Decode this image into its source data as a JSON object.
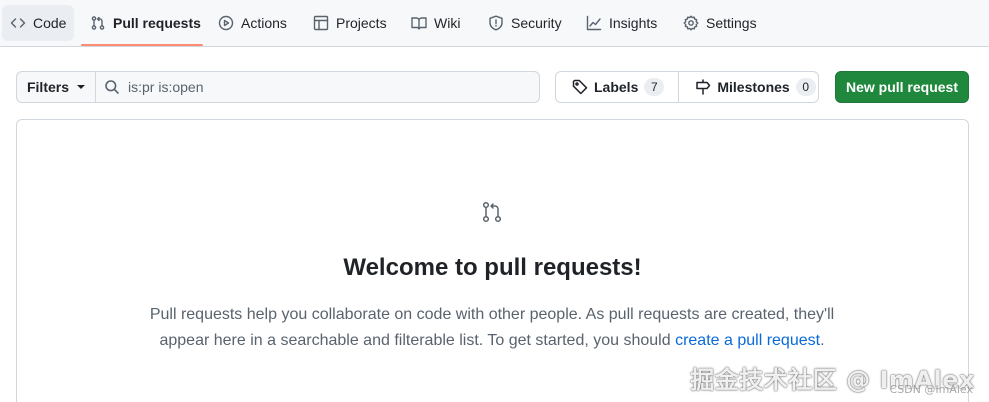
{
  "nav": {
    "tabs": [
      {
        "label": "Code",
        "icon": "code-icon"
      },
      {
        "label": "Pull requests",
        "icon": "git-pull-request-icon",
        "selected": true
      },
      {
        "label": "Actions",
        "icon": "play-icon"
      },
      {
        "label": "Projects",
        "icon": "table-icon"
      },
      {
        "label": "Wiki",
        "icon": "book-icon"
      },
      {
        "label": "Security",
        "icon": "shield-icon"
      },
      {
        "label": "Insights",
        "icon": "graph-icon"
      },
      {
        "label": "Settings",
        "icon": "gear-icon"
      }
    ]
  },
  "toolbar": {
    "filters_label": "Filters",
    "search_value": "is:pr is:open",
    "labels_label": "Labels",
    "labels_count": "7",
    "milestones_label": "Milestones",
    "milestones_count": "0",
    "new_pr_label": "New pull request"
  },
  "blankslate": {
    "title": "Welcome to pull requests!",
    "text_before_link": "Pull requests help you collaborate on code with other people. As pull requests are created, they'll appear here in a searchable and filterable list. To get started, you should ",
    "link_text": "create a pull request",
    "text_after_link": "."
  },
  "watermark": {
    "main": "掘金技术社区 @ ImAlex",
    "secondary": "CSDN @ImAlex"
  },
  "colors": {
    "accent_underline": "#fd8c73",
    "primary_button": "#1f883d",
    "link": "#0969da",
    "border": "#d0d7de"
  }
}
